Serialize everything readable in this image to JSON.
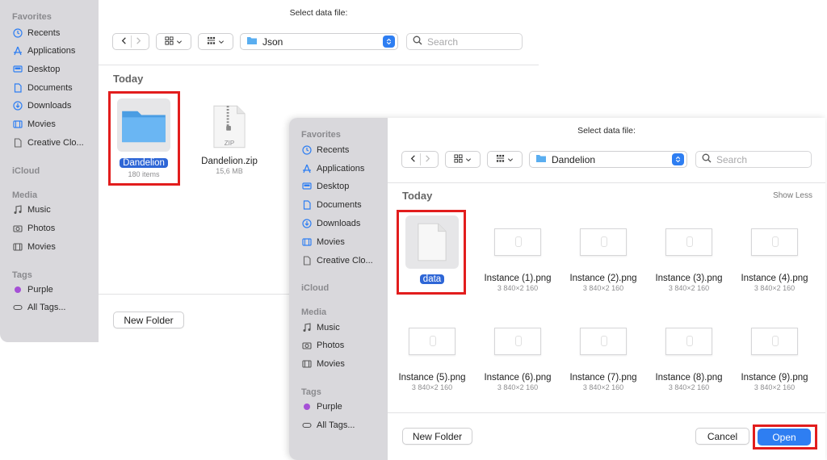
{
  "sidebar": {
    "favorites_label": "Favorites",
    "favorites": [
      {
        "label": "Recents",
        "icon": "clock-icon"
      },
      {
        "label": "Applications",
        "icon": "applications-icon"
      },
      {
        "label": "Desktop",
        "icon": "desktop-icon"
      },
      {
        "label": "Documents",
        "icon": "document-icon"
      },
      {
        "label": "Downloads",
        "icon": "download-icon"
      },
      {
        "label": "Movies",
        "icon": "film-icon"
      },
      {
        "label": "Creative Clo...",
        "icon": "file-icon"
      }
    ],
    "icloud_label": "iCloud",
    "media_label": "Media",
    "media": [
      {
        "label": "Music",
        "icon": "music-icon"
      },
      {
        "label": "Photos",
        "icon": "camera-icon"
      },
      {
        "label": "Movies",
        "icon": "film-icon"
      }
    ],
    "tags_label": "Tags",
    "tags": [
      {
        "label": "Purple",
        "color": "#a550d6"
      },
      {
        "label": "All Tags...",
        "icon": "tag-icon"
      }
    ]
  },
  "dialog1": {
    "title": "Select data file:",
    "location": "Json",
    "search_placeholder": "Search",
    "group_title": "Today",
    "files": [
      {
        "name": "Dandelion",
        "meta": "180 items",
        "type": "folder"
      },
      {
        "name": "Dandelion.zip",
        "meta": "15,6 MB",
        "type": "zip",
        "badge": "ZIP"
      }
    ],
    "new_folder_label": "New Folder"
  },
  "dialog2": {
    "title": "Select data file:",
    "location": "Dandelion",
    "search_placeholder": "Search",
    "group_title": "Today",
    "show_less_label": "Show Less",
    "files": [
      {
        "name": "data",
        "meta": ""
      },
      {
        "name": "Instance (1).png",
        "meta": "3 840×2 160"
      },
      {
        "name": "Instance (2).png",
        "meta": "3 840×2 160"
      },
      {
        "name": "Instance (3).png",
        "meta": "3 840×2 160"
      },
      {
        "name": "Instance (4).png",
        "meta": "3 840×2 160"
      },
      {
        "name": "Instance (5).png",
        "meta": "3 840×2 160"
      },
      {
        "name": "Instance (6).png",
        "meta": "3 840×2 160"
      },
      {
        "name": "Instance (7).png",
        "meta": "3 840×2 160"
      },
      {
        "name": "Instance (8).png",
        "meta": "3 840×2 160"
      },
      {
        "name": "Instance (9).png",
        "meta": "3 840×2 160"
      }
    ],
    "new_folder_label": "New Folder",
    "cancel_label": "Cancel",
    "open_label": "Open"
  },
  "colors": {
    "accent": "#2e7ef2",
    "selection": "#2e66d6",
    "highlight": "#e21d1d",
    "sidebar_bg": "#d9d8dc"
  }
}
